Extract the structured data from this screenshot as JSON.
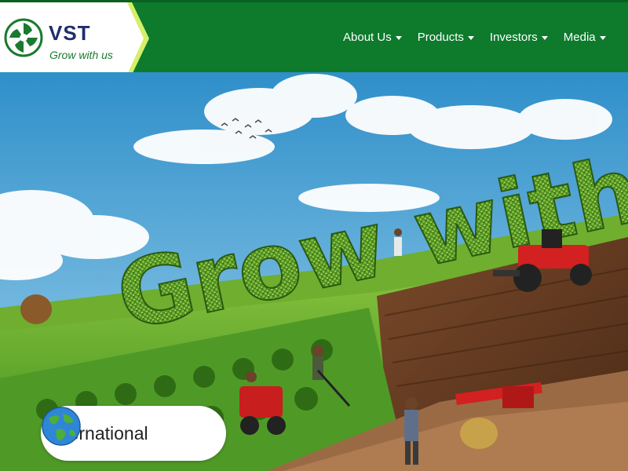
{
  "brand": {
    "name": "VST",
    "tagline": "Grow with us",
    "colors": {
      "header_green": "#0d7a2c",
      "logo_navy": "#1e2f6b",
      "logo_green": "#1a7a2e"
    }
  },
  "nav": {
    "items": [
      {
        "label": "About Us"
      },
      {
        "label": "Products"
      },
      {
        "label": "Investors"
      },
      {
        "label": "Media"
      }
    ]
  },
  "hero": {
    "headline": "Grow with"
  },
  "region": {
    "label": "International",
    "icon": "globe-icon"
  }
}
